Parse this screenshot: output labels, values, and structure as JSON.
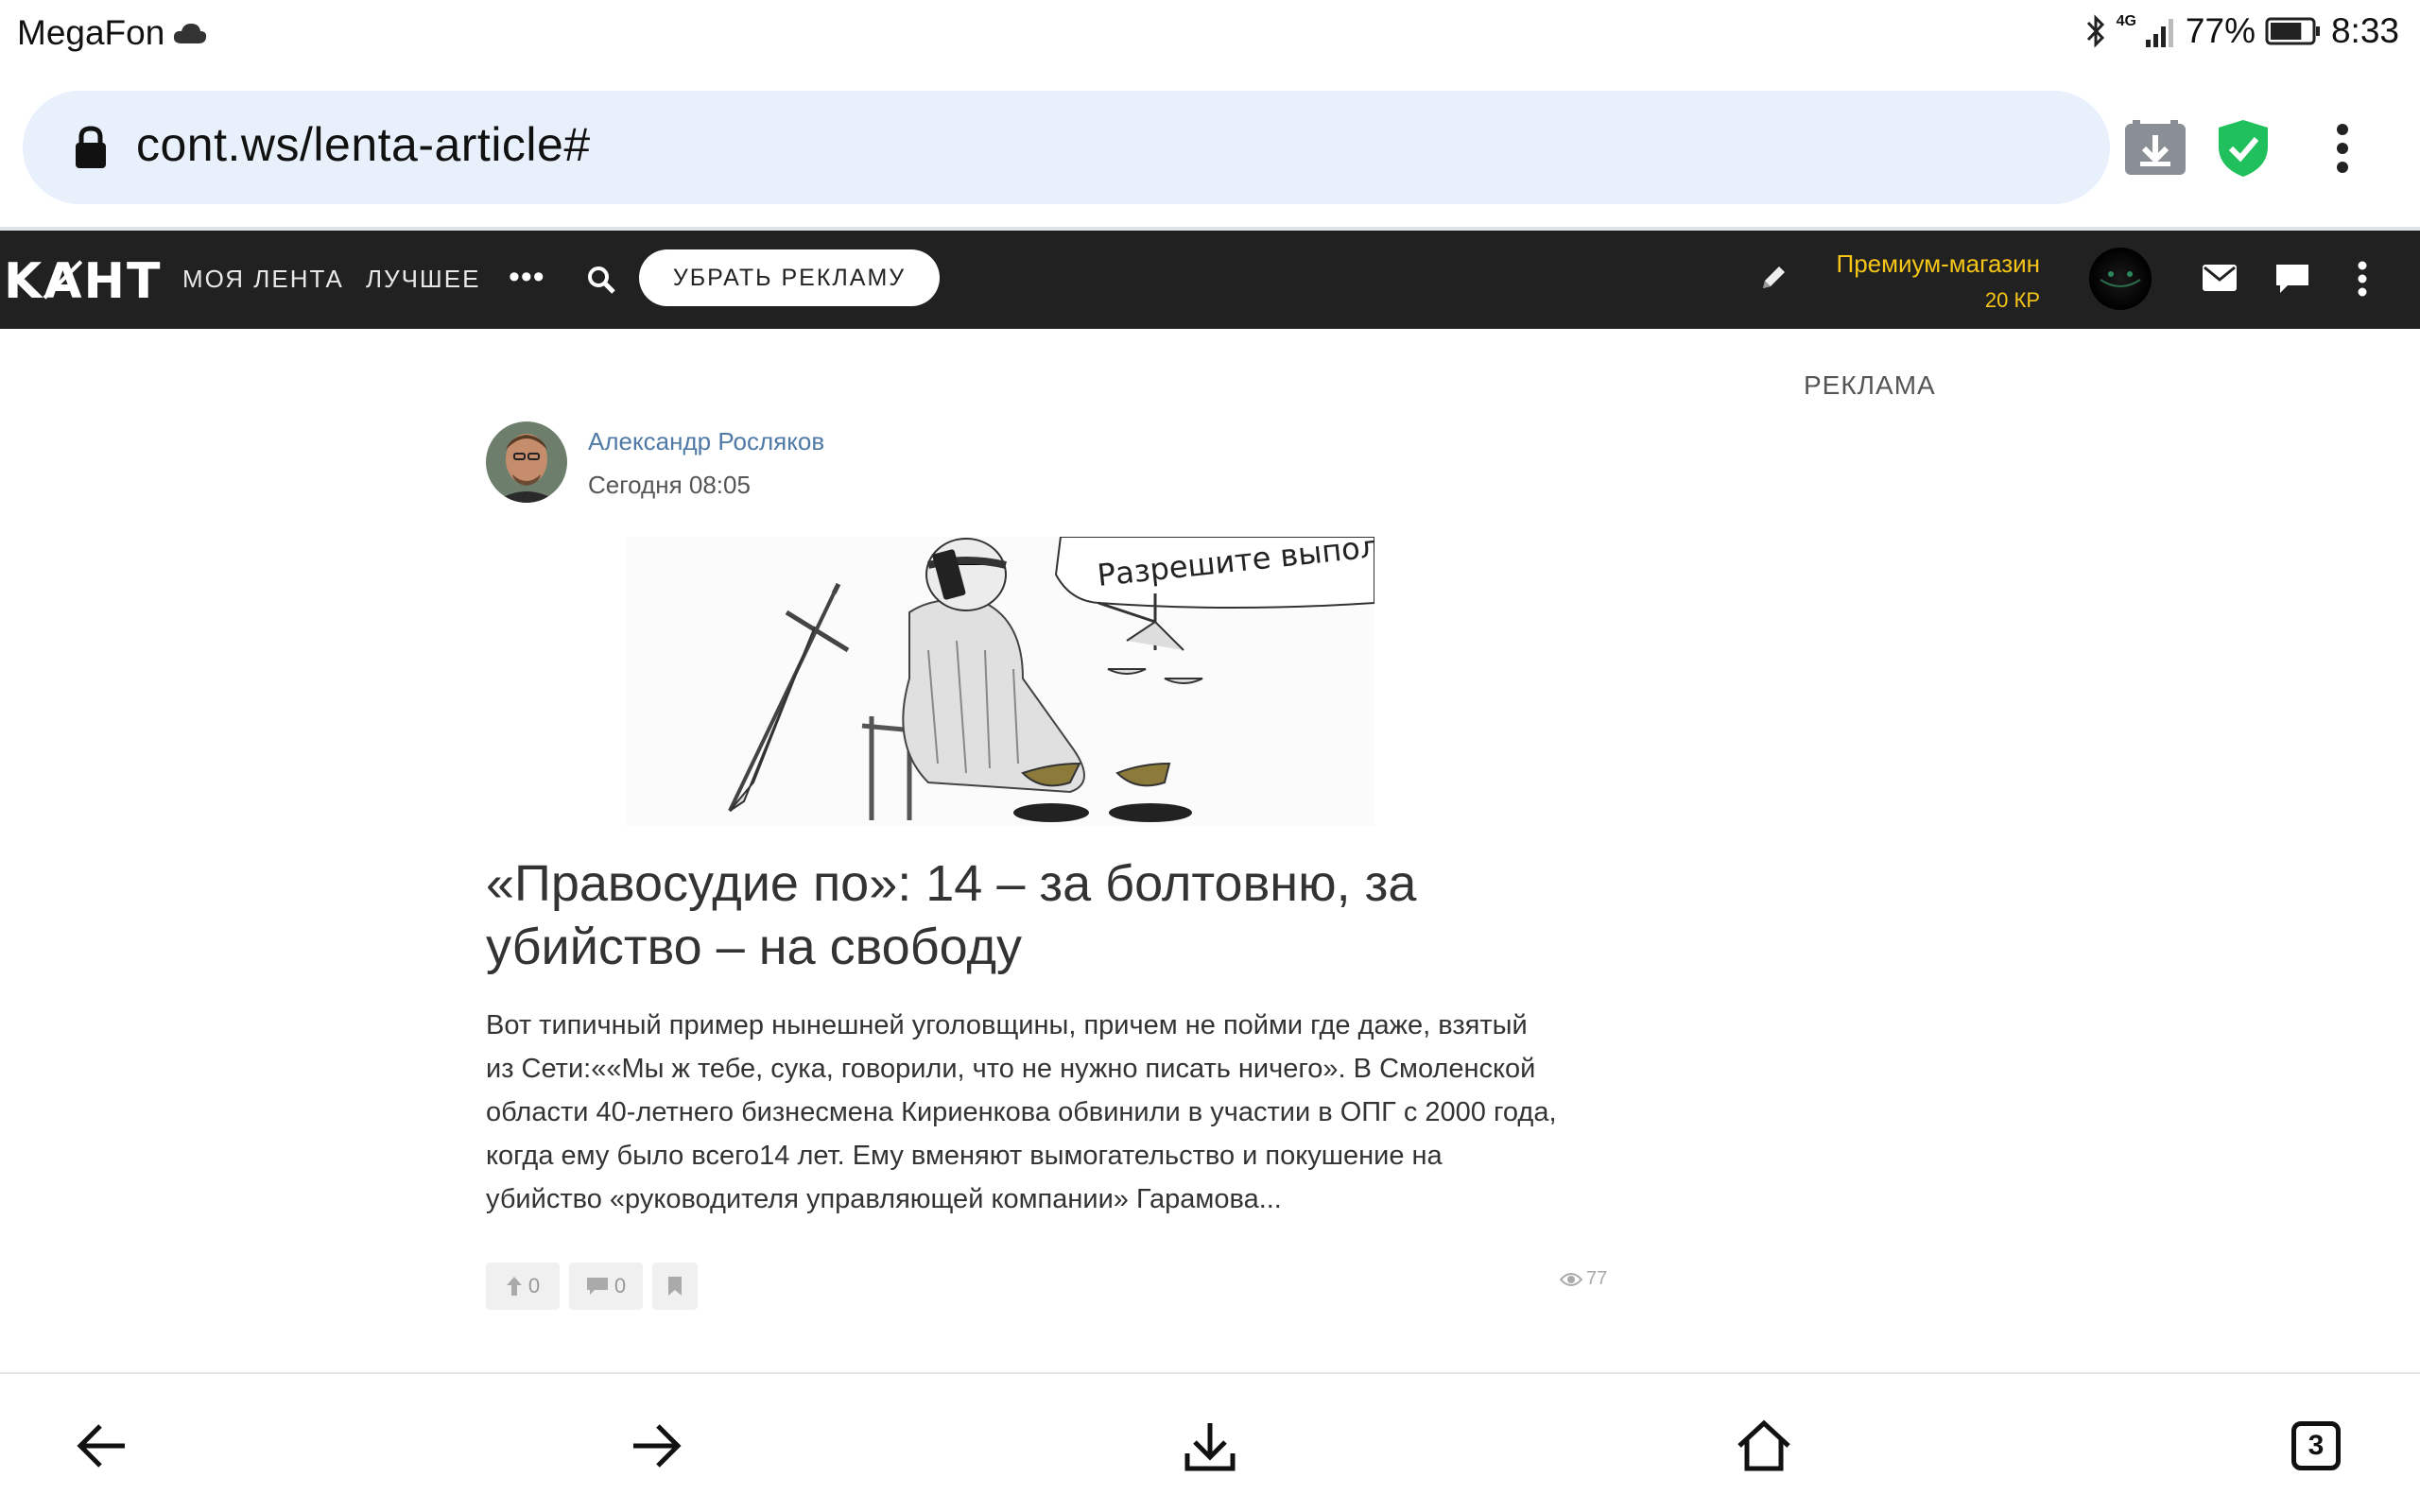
{
  "status_bar": {
    "carrier": "MegaFon",
    "network": "4G",
    "battery": "77%",
    "time": "8:33",
    "battery_level": 0.77
  },
  "browser": {
    "url": "cont.ws/lenta-article#",
    "icons": [
      "lock-icon",
      "download-icon",
      "shield-check-icon",
      "more-vert-icon"
    ],
    "open_tabs": "3"
  },
  "site_header": {
    "logo": "KȺHT",
    "nav": [
      "МОЯ ЛЕНТА",
      "ЛУЧШЕЕ"
    ],
    "more": "•••",
    "remove_ads": "УБРАТЬ РЕКЛАМУ",
    "premium_label": "Премиум-магазин",
    "premium_balance": "20 КР",
    "accent_color": "#f5c518",
    "bg_color": "#212121"
  },
  "sidebar": {
    "ad_label": "РЕКЛАМА"
  },
  "article": {
    "author": "Александр Росляков",
    "date": "Сегодня 08:05",
    "image_caption_text": "Разрешите выполнять!",
    "title": "«Правосудие по»: 14 – за болтовню, за убийство – на свободу",
    "excerpt_lines": [
      "Вот типичный пример нынешней уголовщины, причем не пойми где даже, взятый",
      "из Сети:««Мы ж тебе, сука, говорили, что не нужно писать ничего». В Смоленской",
      "области 40-летнего бизнесмена Кириенкова обвинили в участии в ОПГ с 2000 года,",
      "когда ему было всего14 лет. Ему вменяют вымогательство и покушение на",
      "убийство «руководителя управляющей компании» Гарамова..."
    ],
    "upvotes": "0",
    "comments": "0",
    "views": "77"
  }
}
